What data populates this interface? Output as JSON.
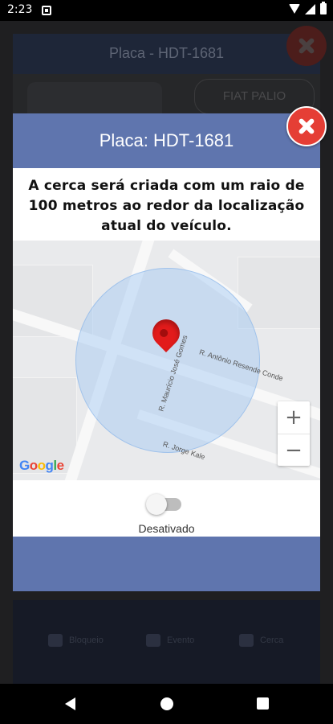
{
  "status_bar": {
    "time": "2:23"
  },
  "background_app": {
    "title": "Placa - HDT-1681",
    "vehicle_model": "FIAT PALIO",
    "nav": [
      {
        "label": "Bloqueio",
        "icon": "car-lock-icon"
      },
      {
        "label": "Evento",
        "icon": "alert-car-icon"
      },
      {
        "label": "Cerca",
        "icon": "globe-icon"
      }
    ]
  },
  "modal": {
    "title": "Placa: HDT-1681",
    "message": "A cerca será criada com um raio de 100 metros ao redor da localização atual do veículo.",
    "map": {
      "streets": [
        "R. Maurício José Gomes",
        "R. Antônio Resende Conde",
        "R. Jorge Kale"
      ],
      "zoom_in": "+",
      "zoom_out": "−",
      "logo_letters": [
        "G",
        "o",
        "o",
        "g",
        "l",
        "e"
      ],
      "geofence_color": "#a0c8f5",
      "pin_color": "#e21b1b"
    },
    "toggle": {
      "state": "off",
      "label": "Desativado"
    },
    "header_color": "#5f75ae",
    "close_color": "#e53e35"
  }
}
